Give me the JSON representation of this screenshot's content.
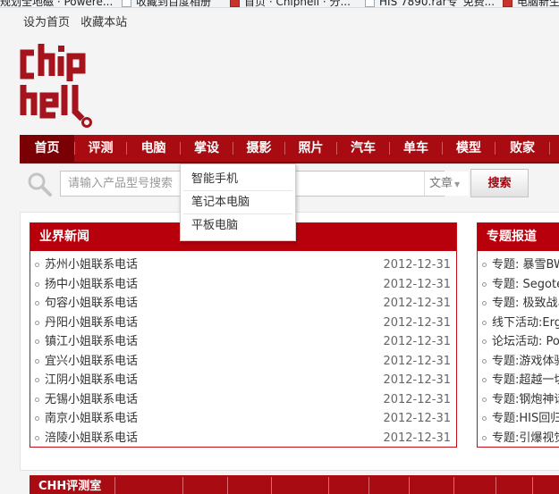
{
  "bookmarks": [
    {
      "label": "规划全地磁 · Powere...",
      "icon": "page-icon"
    },
    {
      "label": "收藏到百度相册",
      "icon": "page-icon"
    },
    {
      "label": "首页 · Chiphell · 分...",
      "icon": "chiphell-icon"
    },
    {
      "label": "HIS 7890.rar专_免费...",
      "icon": "page-icon"
    },
    {
      "label": "电脑新生",
      "icon": "chiphell-icon"
    }
  ],
  "top_links": [
    "设为首页",
    "收藏本站"
  ],
  "logo": {
    "text": "chiphell",
    "color": "#a5141c"
  },
  "nav": {
    "items": [
      "首页",
      "评测",
      "电脑",
      "掌设",
      "摄影",
      "照片",
      "汽车",
      "单车",
      "模型",
      "败家"
    ]
  },
  "search": {
    "placeholder": "请输入产品型号搜索",
    "select_value": "文章",
    "button_label": "搜索"
  },
  "dropdown": {
    "items": [
      "智能手机",
      "笔记本电脑",
      "平板电脑"
    ]
  },
  "news": {
    "title": "业界新闻",
    "items": [
      {
        "title": "苏州小姐联系电话",
        "date": "2012-12-31"
      },
      {
        "title": "扬中小姐联系电话",
        "date": "2012-12-31"
      },
      {
        "title": "句容小姐联系电话",
        "date": "2012-12-31"
      },
      {
        "title": "丹阳小姐联系电话",
        "date": "2012-12-31"
      },
      {
        "title": "镇江小姐联系电话",
        "date": "2012-12-31"
      },
      {
        "title": "宜兴小姐联系电话",
        "date": "2012-12-31"
      },
      {
        "title": "江阴小姐联系电话",
        "date": "2012-12-31"
      },
      {
        "title": "无锡小姐联系电话",
        "date": "2012-12-31"
      },
      {
        "title": "南京小姐联系电话",
        "date": "2012-12-31"
      },
      {
        "title": "涪陵小姐联系电话",
        "date": "2012-12-31"
      }
    ]
  },
  "topics": {
    "title": "专题报道",
    "items": [
      "专题: 暴雪BW",
      "专题: Segote",
      "专题: 极致战斗",
      "线下活动:Erg",
      "论坛活动: Pow",
      "专题:游戏体验",
      "专题:超越一切",
      "专题:钢炮神话",
      "专题:HIS回归",
      "专题:引爆视觉"
    ]
  },
  "lab": {
    "title": "CHH评测室"
  },
  "colors": {
    "brand_red": "#a80c12",
    "header_red": "#b8000c",
    "active_nav": "#7a0006"
  }
}
